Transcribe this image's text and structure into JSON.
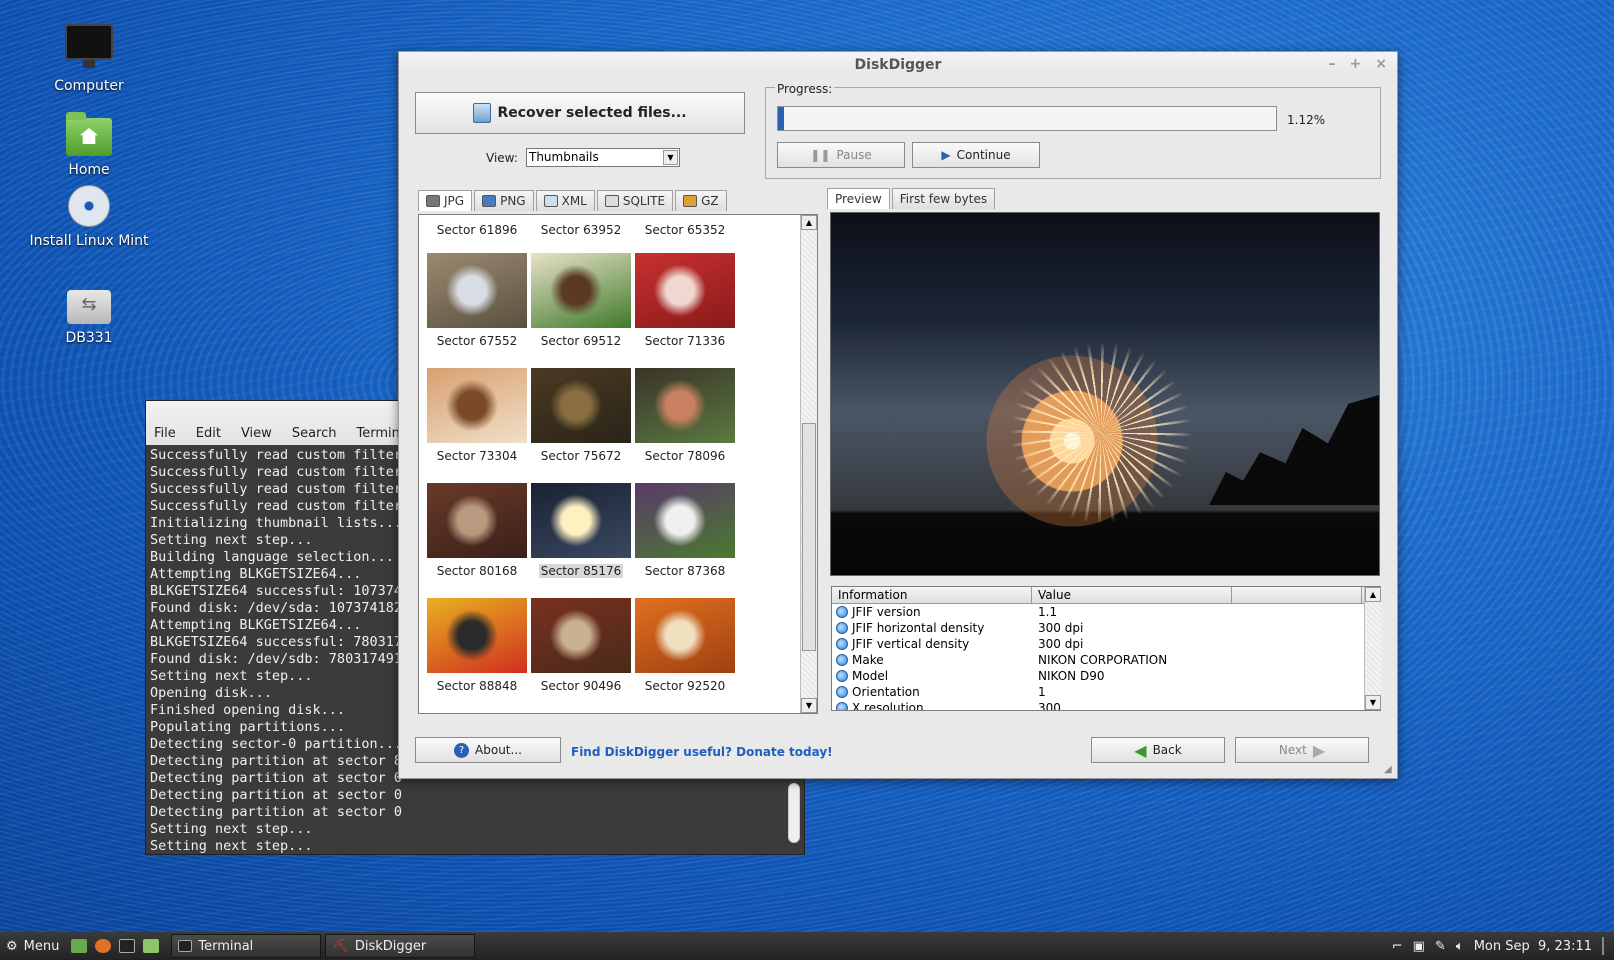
{
  "desktop": {
    "icons": [
      {
        "label": "Computer"
      },
      {
        "label": "Home"
      },
      {
        "label": "Install Linux Mint"
      },
      {
        "label": "DB331"
      }
    ]
  },
  "terminal": {
    "menu": [
      "File",
      "Edit",
      "View",
      "Search",
      "Terminal"
    ],
    "lines": [
      "Successfully read custom filter",
      "Successfully read custom filter",
      "Successfully read custom filter",
      "Successfully read custom filter",
      "Initializing thumbnail lists...",
      "Setting next step...",
      "Building language selection...",
      "Attempting BLKGETSIZE64...",
      "BLKGETSIZE64 successful: 107374",
      "Found disk: /dev/sda: 107374182",
      "Attempting BLKGETSIZE64...",
      "BLKGETSIZE64 successful: 780317",
      "Found disk: /dev/sdb: 780317491",
      "Setting next step...",
      "Opening disk...",
      "Finished opening disk...",
      "Populating partitions...",
      "Detecting sector-0 partition...",
      "Detecting partition at sector 8",
      "Detecting partition at sector 0",
      "Detecting partition at sector 0",
      "Detecting partition at sector 0",
      "Setting next step...",
      "Setting next step..."
    ]
  },
  "diskdigger": {
    "title": "DiskDigger",
    "window_controls": [
      "–",
      "+",
      "×"
    ],
    "recover_label": "Recover selected files...",
    "view_label": "View:",
    "view_value": "Thumbnails",
    "progress": {
      "label": "Progress:",
      "percent_text": "1.12%",
      "fraction": 0.0112
    },
    "pause_label": "Pause",
    "continue_label": "Continue",
    "file_tabs": [
      "JPG",
      "PNG",
      "XML",
      "SQLITE",
      "GZ"
    ],
    "top_row": [
      "Sector 61896",
      "Sector 63952",
      "Sector 65352"
    ],
    "thumbnails": [
      {
        "label": "Sector 67552",
        "colors": [
          "#9a8a70",
          "#d8dce4",
          "#5b5040"
        ]
      },
      {
        "label": "Sector 69512",
        "colors": [
          "#e8e2c8",
          "#5a3a22",
          "#3f7a2a"
        ]
      },
      {
        "label": "Sector 71336",
        "colors": [
          "#c83030",
          "#f0d8d0",
          "#8a1a1a"
        ]
      },
      {
        "label": "Sector 73304",
        "colors": [
          "#d8a070",
          "#7a4a28",
          "#f0e0c8"
        ]
      },
      {
        "label": "Sector 75672",
        "colors": [
          "#4a3a22",
          "#8a7040",
          "#2a2418"
        ]
      },
      {
        "label": "Sector 78096",
        "colors": [
          "#3a3428",
          "#c88060",
          "#5a7a40"
        ]
      },
      {
        "label": "Sector 80168",
        "colors": [
          "#6a3a2a",
          "#b89a80",
          "#3a2018"
        ]
      },
      {
        "label": "Sector 85176",
        "colors": [
          "#1a2234",
          "#fff0c0",
          "#3a4860"
        ],
        "selected": true
      },
      {
        "label": "Sector 87368",
        "colors": [
          "#5a3a6a",
          "#f0f0f0",
          "#4a7a30"
        ]
      },
      {
        "label": "Sector 88848",
        "colors": [
          "#e8b020",
          "#2a2a2a",
          "#d03020"
        ]
      },
      {
        "label": "Sector 90496",
        "colors": [
          "#7a3020",
          "#c8b090",
          "#4a2a1a"
        ]
      },
      {
        "label": "Sector 92520",
        "colors": [
          "#e07020",
          "#f0e0c0",
          "#a04010"
        ]
      }
    ],
    "preview_tabs": [
      "Preview",
      "First few bytes"
    ],
    "info": {
      "headers": [
        "Information",
        "Value"
      ],
      "rows": [
        {
          "k": "JFIF version",
          "v": "1.1"
        },
        {
          "k": "JFIF horizontal density",
          "v": "300 dpi"
        },
        {
          "k": "JFIF vertical density",
          "v": "300 dpi"
        },
        {
          "k": "Make",
          "v": "NIKON CORPORATION"
        },
        {
          "k": "Model",
          "v": "NIKON D90"
        },
        {
          "k": "Orientation",
          "v": "1"
        },
        {
          "k": "X resolution",
          "v": "300"
        }
      ]
    },
    "about_label": "About...",
    "donate_label": "Find DiskDigger useful? Donate today!",
    "back_label": "Back",
    "next_label": "Next"
  },
  "taskbar": {
    "menu_label": "Menu",
    "tasks": [
      "Terminal",
      "DiskDigger"
    ],
    "clock": "Mon Sep  9, 23:11"
  },
  "colors": {
    "accent": "#2a5fb8",
    "link": "#1e5fbf"
  }
}
